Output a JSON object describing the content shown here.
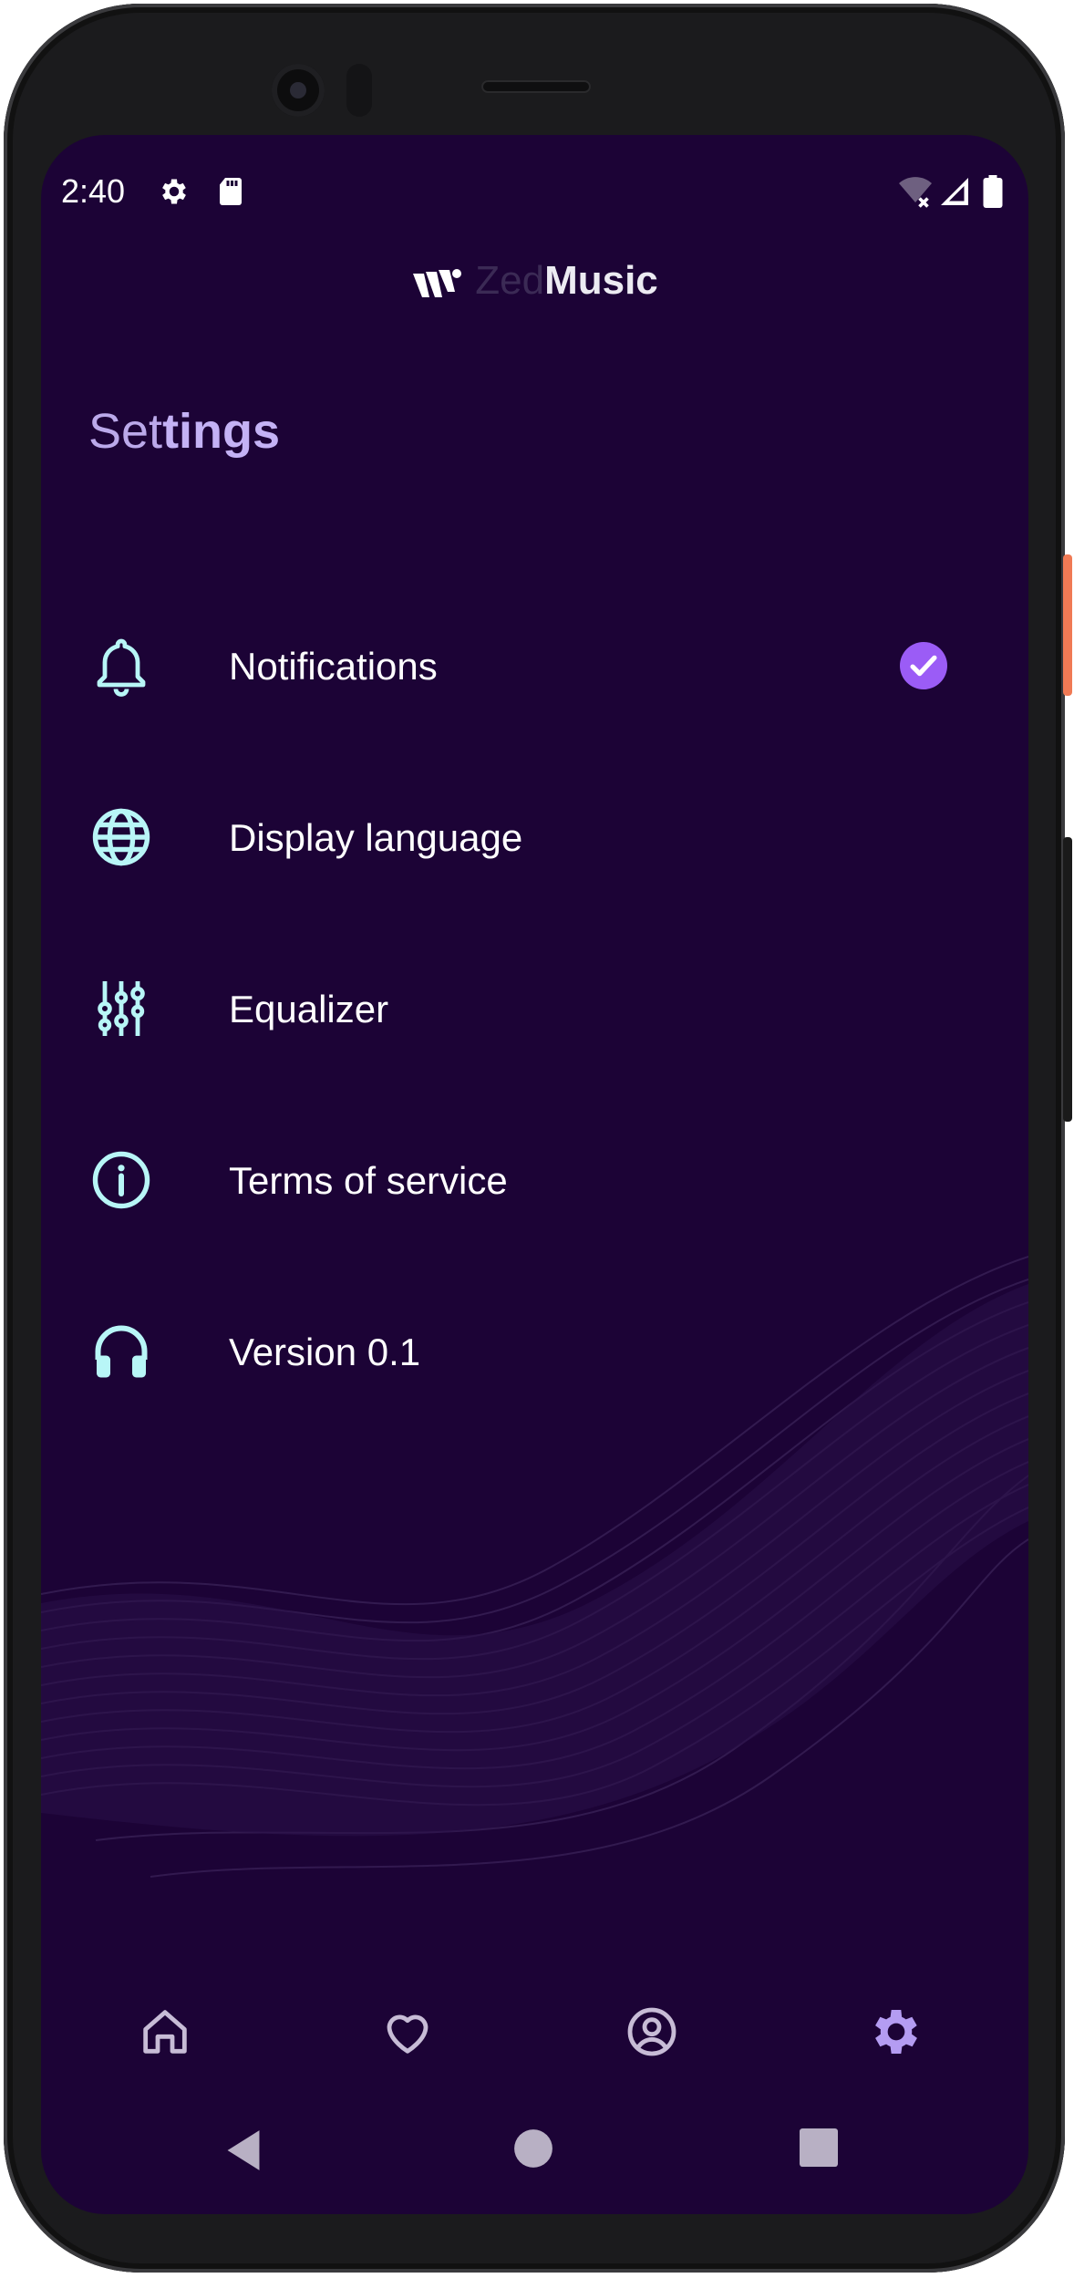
{
  "status_bar": {
    "time": "2:40",
    "icons": [
      "gear-icon",
      "sd-card-icon",
      "wifi-off-icon",
      "cell-signal-icon",
      "battery-icon"
    ]
  },
  "app": {
    "logo_prefix": "Zed",
    "logo_suffix": "Music"
  },
  "page": {
    "title_light": "Set",
    "title_bold": "tings"
  },
  "settings": {
    "items": [
      {
        "label": "Notifications",
        "icon": "bell-icon",
        "checked": true
      },
      {
        "label": "Display language",
        "icon": "globe-icon"
      },
      {
        "label": "Equalizer",
        "icon": "equalizer-icon"
      },
      {
        "label": "Terms of service",
        "icon": "info-icon"
      },
      {
        "label": "Version 0.1",
        "icon": "headphones-icon"
      }
    ]
  },
  "bottom_nav": {
    "items": [
      "home-icon",
      "heart-icon",
      "profile-icon",
      "settings-gear-icon"
    ],
    "active": "settings-gear-icon"
  },
  "colors": {
    "background": "#1c0336",
    "accent": "#9b5cf6",
    "icon_cyan": "#b8f6f7",
    "title": "#c4b2f5",
    "nav_inactive": "#c7bcd6",
    "nav_active": "#b49cf2"
  }
}
